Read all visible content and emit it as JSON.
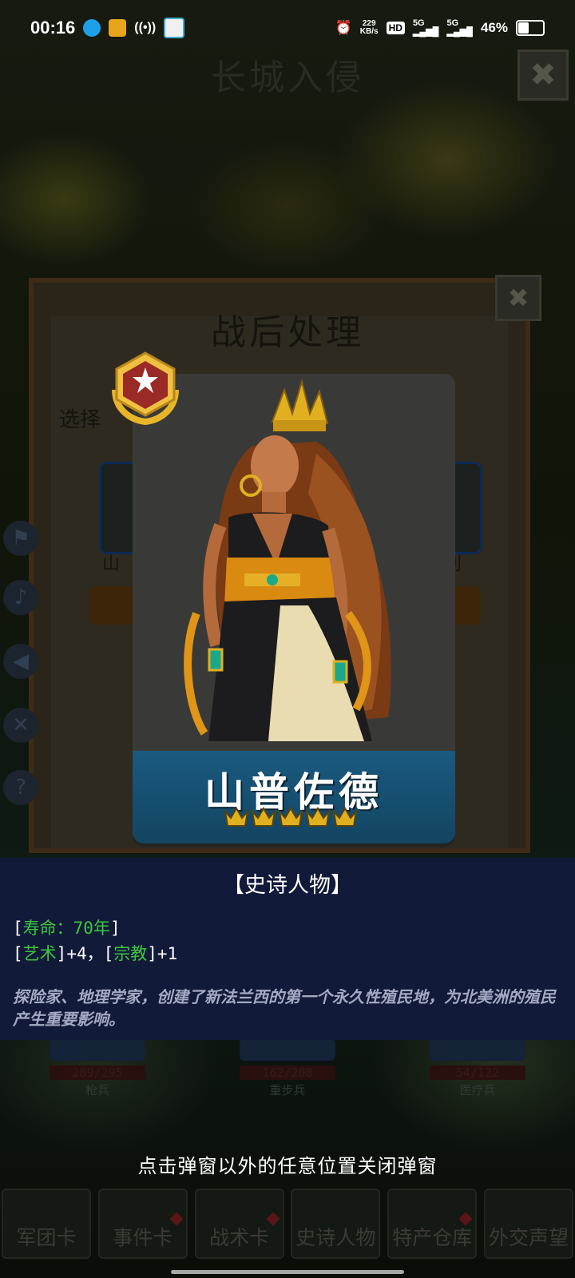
{
  "status_bar": {
    "time": "00:16",
    "net_speed_value": "229",
    "net_speed_unit": "KB/s",
    "hd_label": "HD",
    "signal_1": "5G",
    "signal_2": "5G",
    "battery_percent": "46%",
    "battery_level": 0.46
  },
  "game": {
    "title": "长城入侵",
    "close_label": "✖"
  },
  "postwar_panel": {
    "title": "战后处理",
    "select_label": "选择",
    "option_left_name": "山",
    "option_right_name": "利",
    "close_label": "✖"
  },
  "side_buttons": [
    "⚑",
    "♪",
    "◀",
    "✕",
    "?"
  ],
  "character": {
    "name": "山普佐德",
    "stars": 5,
    "rarity_label": "【史诗人物】",
    "lifespan_open": "[",
    "lifespan_text": "寿命：70年",
    "lifespan_close": "]",
    "attr_1_name": "艺术",
    "attr_1_value": "+4",
    "attr_2_name": "宗教",
    "attr_2_value": "+1",
    "description": "探险家、地理学家，创建了新法兰西的第一个永久性殖民地，为北美洲的殖民产生重要影响。"
  },
  "troops": [
    {
      "count": "289/295",
      "name": "枪兵"
    },
    {
      "count": "162/208",
      "name": "重步兵"
    },
    {
      "count": "54/122",
      "name": "医疗兵"
    }
  ],
  "hint": "点击弹窗以外的任意位置关闭弹窗",
  "bottom_tabs": [
    "军团卡",
    "事件卡",
    "战术卡",
    "史诗人物",
    "特产仓库",
    "外交声望"
  ],
  "colors": {
    "attribute_green": "#3fc63f",
    "name_band_blue": "#1a5a80",
    "info_panel_bg": "#121a3a",
    "crown_gold": "#e0b020"
  }
}
